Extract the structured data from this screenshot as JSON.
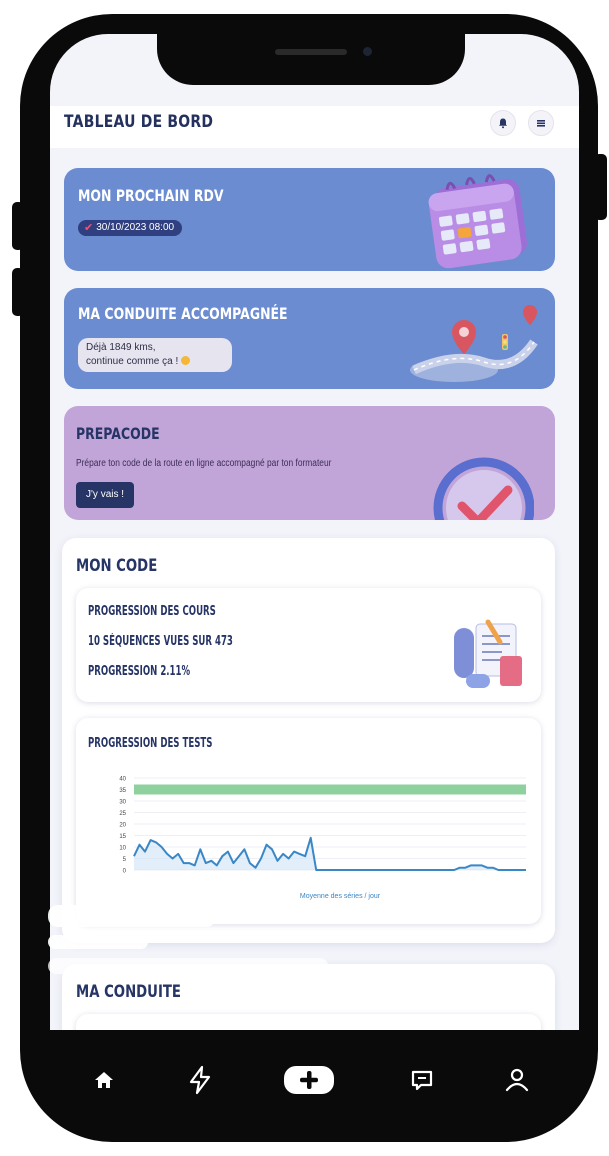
{
  "header": {
    "title": "TABLEAU DE BORD",
    "bell_icon": "bell-icon",
    "menu_icon": "menu-icon"
  },
  "rdv": {
    "title": "MON PROCHAIN RDV",
    "date": "30/10/2023 08:00",
    "icon": "check-icon",
    "illustration": "calendar-icon"
  },
  "conduite_accompagnee": {
    "title": "MA CONDUITE ACCOMPAGNÉE",
    "message_line1": "Déjà 1849 kms,",
    "message_line2": "continue comme ça !",
    "emoji": "smile-emoji",
    "illustration": "map-route-icon"
  },
  "prepacode": {
    "title": "PREPACODE",
    "description": "Prépare ton code de la route en ligne accompagné par ton formateur",
    "button": "J'y vais !",
    "illustration": "clock-check-icon"
  },
  "mon_code": {
    "title": "MON CODE",
    "cours": {
      "title": "PROGRESSION DES COURS",
      "sequences": "10 SÉQUENCES VUES SUR 473",
      "progression": "PROGRESSION 2.11%",
      "progress_fraction": 0.0211
    },
    "tests": {
      "title": "PROGRESSION DES TESTS"
    }
  },
  "ma_conduite": {
    "title": "MA CONDUITE"
  },
  "nav": {
    "items": [
      "home-icon",
      "bolt-icon",
      "add-icon",
      "message-icon",
      "profile-icon"
    ]
  },
  "colors": {
    "primary": "#263466",
    "blue_card": "#6a8bd0",
    "purple_card": "#c3a6d8",
    "chart_line": "#3a87c7",
    "chart_threshold": "#8fd19e"
  },
  "chart_data": {
    "type": "line",
    "xlabel": "Moyenne des séries / jour",
    "ylabel": "",
    "ylim": [
      0,
      40
    ],
    "yticks": [
      0,
      5,
      10,
      15,
      20,
      25,
      30,
      35,
      40
    ],
    "threshold": 35,
    "series": [
      {
        "values": [
          6,
          11,
          8,
          13,
          12,
          10,
          7,
          5,
          7,
          3,
          3,
          2,
          9,
          3,
          4,
          2,
          6,
          8,
          3,
          6,
          9,
          3,
          1,
          5,
          11,
          9,
          4,
          7,
          5,
          8,
          7,
          6,
          14,
          0,
          0,
          0,
          0,
          0,
          0,
          0,
          0,
          0,
          0,
          0,
          0,
          0,
          0,
          0,
          0,
          0,
          0,
          0,
          0,
          0,
          0,
          0,
          0,
          0,
          0,
          1,
          1,
          2,
          2,
          2,
          1,
          1,
          0,
          0,
          0,
          0,
          0,
          0
        ]
      }
    ]
  }
}
